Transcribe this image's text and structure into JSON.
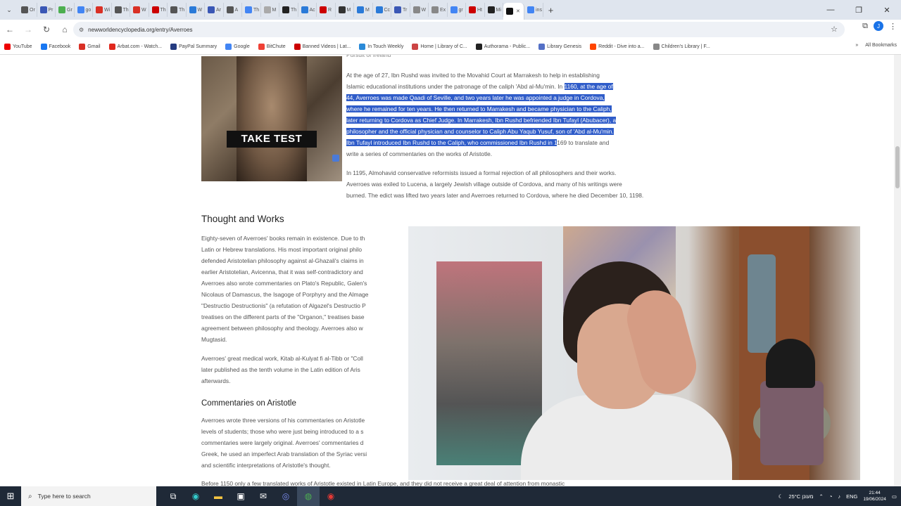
{
  "browser": {
    "tabs": [
      {
        "label": "Or",
        "color": "#555"
      },
      {
        "label": "Pr",
        "color": "#3a57b5"
      },
      {
        "label": "Gr",
        "color": "#4caf50"
      },
      {
        "label": "go",
        "color": "#4285f4"
      },
      {
        "label": "Wi",
        "color": "#d93025"
      },
      {
        "label": "Th",
        "color": "#555"
      },
      {
        "label": "W",
        "color": "#d93025"
      },
      {
        "label": "Th",
        "color": "#c00"
      },
      {
        "label": "Th",
        "color": "#555"
      },
      {
        "label": "W",
        "color": "#2a7ad8"
      },
      {
        "label": "Ar",
        "color": "#3a57b5"
      },
      {
        "label": "A",
        "color": "#555"
      },
      {
        "label": "Th",
        "color": "#4285f4"
      },
      {
        "label": "M",
        "color": "#aaa"
      },
      {
        "label": "Th",
        "color": "#222"
      },
      {
        "label": "Ac",
        "color": "#2a7ad8"
      },
      {
        "label": "R",
        "color": "#c00"
      },
      {
        "label": "M",
        "color": "#333"
      },
      {
        "label": "M",
        "color": "#2a7ad8"
      },
      {
        "label": "Cc",
        "color": "#2a7ad8"
      },
      {
        "label": "Tr",
        "color": "#3a57b5"
      },
      {
        "label": "W",
        "color": "#888"
      },
      {
        "label": "Ex",
        "color": "#888"
      },
      {
        "label": "gr",
        "color": "#4285f4"
      },
      {
        "label": "Ht",
        "color": "#c00"
      },
      {
        "label": "Mi",
        "color": "#222"
      },
      {
        "label": "",
        "color": "#111",
        "active": true
      },
      {
        "label": "ins",
        "color": "#4285f4"
      }
    ],
    "new_tab": "+",
    "window_controls": {
      "minimize": "—",
      "restore": "❐",
      "close": "✕"
    },
    "url": "newworldencyclopedia.org/entry/Averroes",
    "profile_initial": "J"
  },
  "bookmarks": [
    {
      "label": "YouTube",
      "color": "#e00"
    },
    {
      "label": "Facebook",
      "color": "#1877f2"
    },
    {
      "label": "Gmail",
      "color": "#d93025"
    },
    {
      "label": "Arbat.com - Watch...",
      "color": "#e0281e"
    },
    {
      "label": "PayPal Summary",
      "color": "#253b80"
    },
    {
      "label": "Google",
      "color": "#4285f4"
    },
    {
      "label": "BitChute",
      "color": "#ef4136"
    },
    {
      "label": "Banned Videos | Lat...",
      "color": "#c00"
    },
    {
      "label": "In Touch Weekly",
      "color": "#2a8ad8"
    },
    {
      "label": "Home | Library of C...",
      "color": "#c44"
    },
    {
      "label": "Authorama - Public...",
      "color": "#222"
    },
    {
      "label": "Library Genesis",
      "color": "#5470c6"
    },
    {
      "label": "Reddit - Dive into a...",
      "color": "#ff4500"
    },
    {
      "label": "Children's Library | F...",
      "color": "#888"
    }
  ],
  "bookmarks_more": "»",
  "all_bookmarks": "All Bookmarks",
  "ad": {
    "label": "TAKE TEST"
  },
  "article": {
    "para_top_fragment": "Pursuit of Ireland",
    "p1_lines": [
      {
        "pre": "At the age of 27, Ibn Rushd was invited to the Movahid Court at Marrakesh to help in establishing",
        "hl": ""
      },
      {
        "pre": "Islamic educational institutions under the patronage of the caliph 'Abd al-Mu'min. In ",
        "hl": "1160, at the age of"
      },
      {
        "pre": "",
        "hl": "44, Averroes was made Qaadi of Seville, and two years later he was appointed a judge in Cordova,"
      },
      {
        "pre": "",
        "hl": "where he remained for ten years. He then returned to Marrakesh and became physician to the Caliph,"
      },
      {
        "pre": "",
        "hl": "later returning to Cordova as Chief Judge. In Marrakesh, Ibn Rushd befriended Ibn Tufayl (Abubacer), a"
      },
      {
        "pre": "",
        "hl": "philosopher and the official physician and counselor to Caliph Abu Yaqub Yusuf, son of 'Abd al-Mu'min."
      },
      {
        "pre": "",
        "hl": "Ibn Tufayl introduced Ibn Rushd to the Caliph, who commissioned Ibn Rushd in 1",
        "post": "169 to translate and"
      },
      {
        "pre": "write a series of commentaries on the works of Aristotle.",
        "hl": ""
      }
    ],
    "p2_lines": [
      "In 1195, Almohavid conservative reformists issued a formal rejection of all philosophers and their works.",
      "Averroes was exiled to Lucena, a largely Jewish village outside of Cordova, and many of his writings were",
      "burned. The edict was lifted two years later and Averroes returned to Cordova, where he died December 10, 1198."
    ],
    "h2": "Thought and Works",
    "tw_lines": [
      "Eighty-seven of Averroes' books remain in existence. Due to th",
      "Latin or Hebrew translations. His most important original philo",
      "defended Aristotelian philosophy against al-Ghazali's claims in",
      "earlier Aristotelian, Avicenna, that it was self-contradictory and",
      "Averroes also wrote commentaries on Plato's Republic, Galen's",
      "Nicolaus of Damascus, the Isagoge of Porphyry and the Almage",
      "\"Destructio Destructionis\" (a refutation of Algazel's Destructio P",
      "treatises on the different parts of the \"Organon,\" treatises base",
      "agreement between philosophy and theology. Averroes also w",
      "Mugtasid."
    ],
    "med_lines": [
      "Averroes' great medical work, Kitab al-Kulyat fi al-Tibb or \"Coll",
      "later published as the tenth volume in the Latin edition of Aris",
      "afterwards."
    ],
    "h3": "Commentaries on Aristotle",
    "com_lines": [
      "Averroes wrote three versions of his commentaries on Aristotle",
      "levels of students; those who were just being introduced to a s",
      "commentaries were largely original. Averroes' commentaries d",
      "Greek, he used an imperfect Arab translation of the Syriac versi",
      "and scientific interpretations of Aristotle's thought."
    ],
    "last_line": "Before 1150 only a few translated works of Aristotle existed in Latin Europe, and they did not receive a great deal of attention from monastic"
  },
  "taskbar": {
    "search_placeholder": "Type here to search",
    "weather": "25°C  מעונן",
    "lang": "ENG",
    "time": "21:44",
    "date": "19/06/2024"
  }
}
